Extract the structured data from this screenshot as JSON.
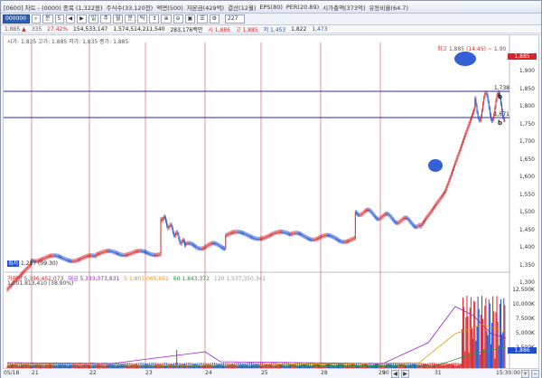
{
  "window": {
    "title_items": [
      "[0600] 차트 - (0000) 종목 (1,322원)",
      "주식수(33,120천)",
      "액면(500)",
      "자본금(429억)",
      "결산(12월)",
      "EPS(80)",
      "PER(20.89)",
      "시가총액(373억)",
      "유동비율(64.7)"
    ]
  },
  "toolbar": {
    "code": "000000",
    "period_label": "분",
    "tick_label": "5",
    "count_value": "227",
    "buttons": [
      "◀",
      "▶",
      "일",
      "주",
      "월",
      "분",
      "틱",
      "↕",
      "⊕",
      "⊖",
      "▣",
      "☰",
      "⚙"
    ]
  },
  "pricebar": {
    "items": [
      {
        "text": "1,885 ▲",
        "cls": "up"
      },
      {
        "text": "335",
        "cls": "up"
      },
      {
        "text": "27.42%",
        "cls": "up"
      },
      {
        "text": "154,533,147",
        "cls": ""
      },
      {
        "text": "1,574,514,211,540",
        "cls": ""
      },
      {
        "text": "283,176백만",
        "cls": ""
      },
      {
        "text": "시 1,886",
        "cls": "up"
      },
      {
        "text": "고 1,885",
        "cls": "up"
      },
      {
        "text": "저 1,453",
        "cls": "dn"
      },
      {
        "text": "1,822",
        "cls": ""
      },
      {
        "text": "1,473",
        "cls": "dn"
      }
    ]
  },
  "chart": {
    "legend": "시가: 1,835  고가: 1,885  저가: 1,835  종가: 1,885",
    "high_annotation": "최고 1,885 (14:45) ~ 1.90",
    "low_annotation": {
      "tag": "최저",
      "text": "1,257 (09:30)"
    },
    "y_labels": [
      "1,900",
      "1,850",
      "1,800",
      "1,750",
      "1,700",
      "1,650",
      "1,600",
      "1,550",
      "1,500",
      "1,450",
      "1,400",
      "1,350",
      "1,300"
    ],
    "current_price": "1,885",
    "current_price_color": "#d6262b",
    "hlines": [
      {
        "label": "1,738",
        "marker": "b"
      },
      {
        "label": "1,671",
        "marker": "b"
      }
    ],
    "vol_legend": [
      {
        "text": "거래량 5,396,452,073",
        "color": "#d6262b"
      },
      {
        "text": "대금 5,333,373,831",
        "color": "#9b1fc9"
      },
      {
        "text": "5 1,801,065,651",
        "color": "#e09a00"
      },
      {
        "text": "60 1,843,372",
        "color": "#1f9a2f"
      },
      {
        "text": "120 1,537,350,341",
        "color": "#999999"
      }
    ],
    "vol_legend2": "1,001,813,410 (38.90%)",
    "vol_labels": [
      "12,500K",
      "10,000K",
      "7,500K",
      "5,000K",
      "2,500K"
    ],
    "vol_current": "1,886",
    "x_labels": [
      "05/18",
      "21",
      "22",
      "23",
      "24",
      "25",
      "28",
      "29",
      "30",
      "31"
    ],
    "x_end_label": "15:30:00"
  },
  "colors": {
    "up": "#d6262b",
    "down": "#1f4fd0",
    "grid_vertical": "#d66a6a",
    "hline": "#2a2aa8"
  }
}
